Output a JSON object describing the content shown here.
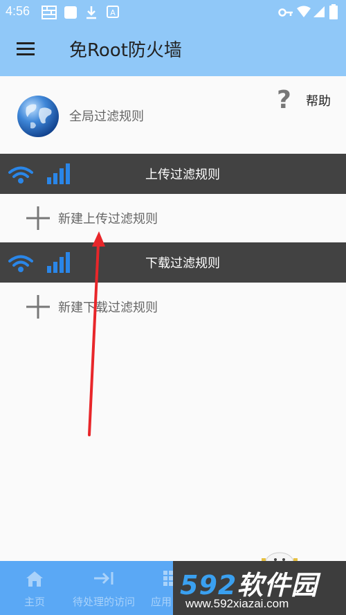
{
  "status_bar": {
    "time": "4:56",
    "icons": [
      "grid-icon",
      "square-icon",
      "download-icon",
      "a-box-icon",
      "key-icon",
      "wifi-icon",
      "signal-icon",
      "battery-icon"
    ]
  },
  "app_bar": {
    "title": "免Root防火墙",
    "menu_icon": "hamburger-icon"
  },
  "global_rules": {
    "label": "全局过滤规则",
    "icon": "globe-icon",
    "help_glyph": "?",
    "help_label": "帮助"
  },
  "upload_section": {
    "header": "上传过滤规则",
    "add_label": "新建上传过滤规则"
  },
  "download_section": {
    "header": "下载过滤规则",
    "add_label": "新建下载过滤规则"
  },
  "bottom_nav": {
    "items": [
      {
        "label": "主页",
        "icon": "home-icon"
      },
      {
        "label": "待处理的访问",
        "icon": "arrow-to-bar-icon"
      },
      {
        "label": "应用",
        "icon": "apps-grid-icon"
      }
    ]
  },
  "watermark": {
    "number": "592",
    "name": "软件园",
    "url": "www.592xiazai.com"
  },
  "colors": {
    "app_bar": "#90c8f8",
    "section_header": "#424242",
    "bottom_nav": "#5aa8f5",
    "icon_blue": "#2a86e8",
    "arrow_red": "#e8262a"
  }
}
